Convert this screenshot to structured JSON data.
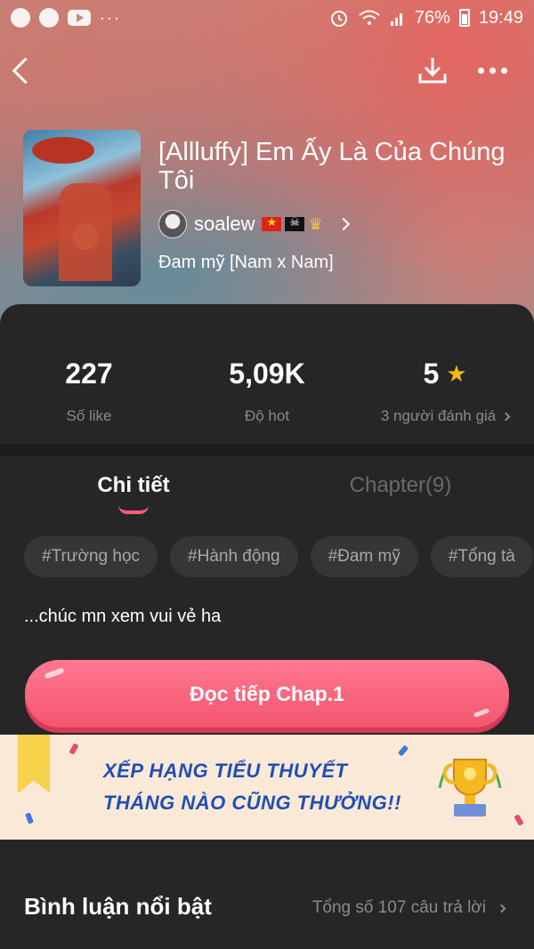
{
  "status_bar": {
    "battery": "76%",
    "time": "19:49",
    "more": "···"
  },
  "book": {
    "title": "[Allluffy] Em Ấy Là Của Chúng Tôi",
    "author": "soalew",
    "genre": "Đam mỹ [Nam x Nam]"
  },
  "stats": {
    "likes_value": "227",
    "likes_label": "Số like",
    "hot_value": "5,09K",
    "hot_label": "Độ hot",
    "rating_value": "5",
    "rating_label": "3 người đánh giá"
  },
  "tabs": {
    "detail": "Chi tiết",
    "chapters": "Chapter(9)"
  },
  "tags": [
    "#Trường học",
    "#Hành động",
    "#Đam mỹ",
    "#Tổng tà"
  ],
  "description": "...chúc mn xem vui vẻ ha",
  "read_button": "Đọc tiếp Chap.1",
  "banner": {
    "line1": "XẾP HẠNG TIỂU THUYẾT",
    "line2": "THÁNG NÀO CŨNG THƯỞNG!!"
  },
  "comments": {
    "title": "Bình luận nổi bật",
    "total": "Tổng số 107 câu trả lời"
  },
  "colors": {
    "accent": "#f4566f",
    "background": "#262626",
    "banner_text": "#1f4fb5",
    "star": "#f6b913"
  }
}
